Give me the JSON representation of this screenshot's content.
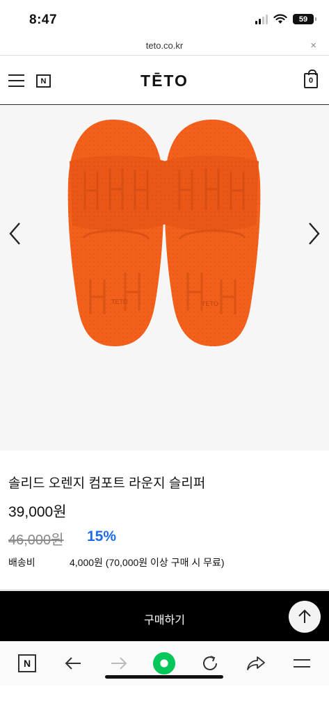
{
  "status_bar": {
    "time": "8:47",
    "battery": "59"
  },
  "browser": {
    "url": "teto.co.kr",
    "close_symbol": "×"
  },
  "site_header": {
    "logo": "TĒTO",
    "n_badge": "N",
    "cart_count": "0"
  },
  "product": {
    "name": "솔리드 오렌지 컴포트 라운지 슬리퍼",
    "price": "39,000원",
    "original_price": "46,000원",
    "discount": "15%",
    "shipping_label": "배송비",
    "shipping_value": "4,000원 (70,000원 이상 구매 시 무료)",
    "image_color": "#f2601c",
    "sole_print": "TETO"
  },
  "buy_bar": {
    "buy_label": "구매하기"
  },
  "toolbar": {
    "n_label": "N"
  },
  "colors": {
    "accent_discount": "#1e6de6",
    "buy_bar_bg": "#000000",
    "naver_green": "#03c75a"
  }
}
